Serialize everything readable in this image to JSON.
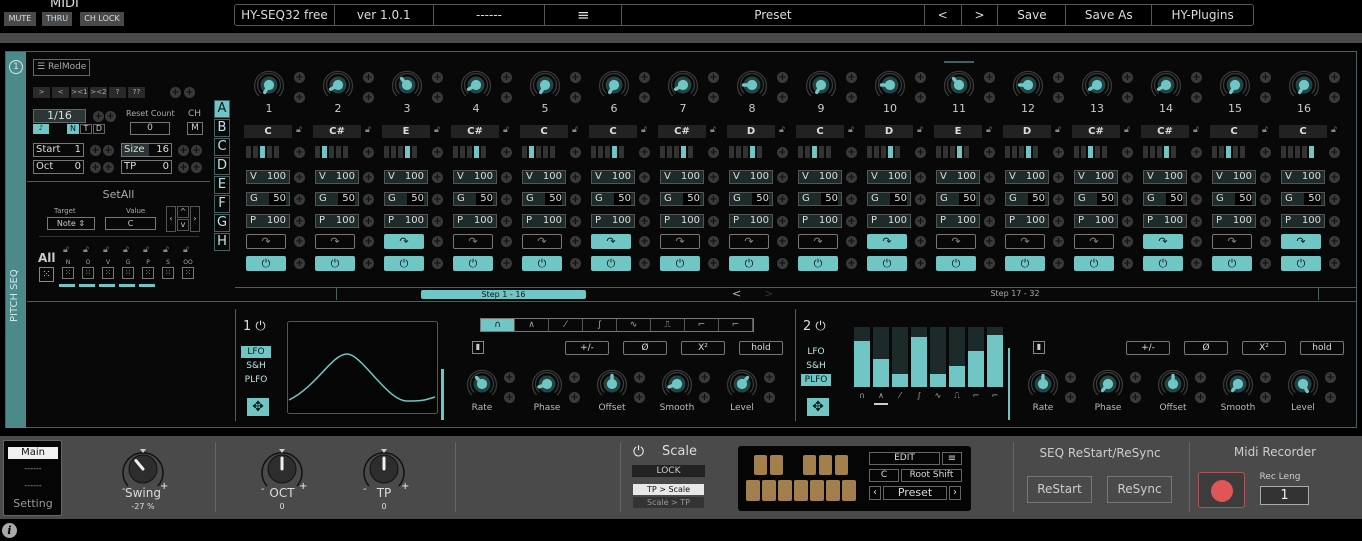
{
  "midi": {
    "title": "MIDI",
    "buttons": [
      "MUTE",
      "THRU",
      "CH LOCK"
    ]
  },
  "header": {
    "plugin": "HY-SEQ32 free",
    "version": "ver 1.0.1",
    "slot": "------",
    "menu_icon": "hamburger-icon",
    "preset": "Preset",
    "prev": "<",
    "next": ">",
    "save": "Save",
    "save_as": "Save As",
    "brand": "HY-Plugins"
  },
  "sidebar": {
    "label": "PITCH SEQ",
    "info": "1"
  },
  "controls": {
    "relmode": "RelMode",
    "directions": [
      ">",
      "<",
      "><1",
      "><2",
      "?",
      "??"
    ],
    "rate": "1/16",
    "rate_types": [
      "N",
      "T",
      "D"
    ],
    "reset_count_label": "Reset Count",
    "reset_count": "0",
    "ch_label": "CH",
    "ch_value": "M",
    "start_label": "Start",
    "start": "1",
    "size_label": "Size",
    "size": "16",
    "oct_label": "Oct",
    "oct": "0",
    "tp_label": "TP",
    "tp": "0",
    "setall": "SetAll",
    "target_label": "Target",
    "target": "Note",
    "value_label": "Value",
    "value": "C",
    "all": "All",
    "random_labels": [
      "N",
      "O",
      "V",
      "G",
      "P",
      "S",
      "OO"
    ]
  },
  "patterns": [
    "A",
    "B",
    "C",
    "D",
    "E",
    "F",
    "G",
    "H"
  ],
  "selected_pattern": "A",
  "steps": [
    {
      "n": "1",
      "note": "C",
      "oct": 2,
      "v": "100",
      "g": "50",
      "p": "100",
      "retrig": false,
      "on": true,
      "knob": -150
    },
    {
      "n": "2",
      "note": "C#",
      "oct": 1,
      "v": "100",
      "g": "50",
      "p": "100",
      "retrig": false,
      "on": true,
      "knob": -120
    },
    {
      "n": "3",
      "note": "E",
      "oct": 3,
      "v": "100",
      "g": "50",
      "p": "100",
      "retrig": true,
      "on": true,
      "knob": -40
    },
    {
      "n": "4",
      "note": "C#",
      "oct": 3,
      "v": "100",
      "g": "50",
      "p": "100",
      "retrig": false,
      "on": true,
      "knob": -120
    },
    {
      "n": "5",
      "note": "C",
      "oct": 1,
      "v": "100",
      "g": "50",
      "p": "100",
      "retrig": false,
      "on": true,
      "knob": -150
    },
    {
      "n": "6",
      "note": "C",
      "oct": 3,
      "v": "100",
      "g": "50",
      "p": "100",
      "retrig": true,
      "on": true,
      "knob": -150
    },
    {
      "n": "7",
      "note": "C#",
      "oct": 3,
      "v": "100",
      "g": "50",
      "p": "100",
      "retrig": false,
      "on": true,
      "knob": -120
    },
    {
      "n": "8",
      "note": "D",
      "oct": 3,
      "v": "100",
      "g": "50",
      "p": "100",
      "retrig": false,
      "on": true,
      "knob": -90
    },
    {
      "n": "9",
      "note": "C",
      "oct": 2,
      "v": "100",
      "g": "50",
      "p": "100",
      "retrig": false,
      "on": true,
      "knob": -150
    },
    {
      "n": "10",
      "note": "D",
      "oct": 3,
      "v": "100",
      "g": "50",
      "p": "100",
      "retrig": true,
      "on": true,
      "knob": -90
    },
    {
      "n": "11",
      "note": "E",
      "oct": 3,
      "v": "100",
      "g": "50",
      "p": "100",
      "retrig": false,
      "on": true,
      "knob": -40
    },
    {
      "n": "12",
      "note": "D",
      "oct": 3,
      "v": "100",
      "g": "50",
      "p": "100",
      "retrig": false,
      "on": true,
      "knob": -90
    },
    {
      "n": "13",
      "note": "C#",
      "oct": 2,
      "v": "100",
      "g": "50",
      "p": "100",
      "retrig": false,
      "on": true,
      "knob": -120
    },
    {
      "n": "14",
      "note": "C#",
      "oct": 3,
      "v": "100",
      "g": "50",
      "p": "100",
      "retrig": true,
      "on": true,
      "knob": -120
    },
    {
      "n": "15",
      "note": "C",
      "oct": 2,
      "v": "100",
      "g": "50",
      "p": "100",
      "retrig": false,
      "on": true,
      "knob": -150
    },
    {
      "n": "16",
      "note": "C",
      "oct": 4,
      "v": "100",
      "g": "50",
      "p": "100",
      "retrig": true,
      "on": true,
      "knob": -150
    }
  ],
  "current_step": "11",
  "step_pages": {
    "page1": "Step   1 - 16",
    "page2": "Step   17 - 32",
    "prev": "<",
    "next": ">"
  },
  "lfo1": {
    "num": "1",
    "modes": [
      "LFO",
      "S&H",
      "PLFO"
    ],
    "selected": "LFO",
    "shapes": [
      "sine",
      "triangle",
      "ramp",
      "s-curve",
      "zigzag",
      "step1",
      "step2",
      "step3"
    ],
    "shape_selected": 0,
    "ops": [
      "+/-",
      "Ø",
      "X²",
      "hold"
    ],
    "knobs": [
      "Rate",
      "Phase",
      "Offset",
      "Smooth",
      "Level"
    ],
    "level": 0.85
  },
  "lfo2": {
    "num": "2",
    "modes": [
      "LFO",
      "S&H",
      "PLFO"
    ],
    "selected": "PLFO",
    "bars": [
      0.77,
      0.46,
      0.22,
      0.83,
      0.22,
      0.35,
      0.6,
      0.87
    ],
    "bar_selected": 1,
    "ops": [
      "+/-",
      "Ø",
      "X²",
      "hold"
    ],
    "knobs": [
      "Rate",
      "Phase",
      "Offset",
      "Smooth",
      "Level"
    ],
    "level": 0.85
  },
  "bottom": {
    "tabs": [
      "Main",
      "------",
      "------",
      "Setting"
    ],
    "active_tab": "Main",
    "swing_label": "Swing",
    "swing_value": "-27 %",
    "oct_label": "OCT",
    "oct_value": "0",
    "tp_label": "TP",
    "tp_value": "0",
    "scale_label": "Scale",
    "lock": "LOCK",
    "tp_scale": "TP > Scale",
    "scale_tp": "Scale > TP",
    "edit": "EDIT",
    "root": "C",
    "root_shift": "Root Shift",
    "preset": "Preset",
    "seq_title": "SEQ ReStart/ReSync",
    "restart": "ReStart",
    "resync": "ReSync",
    "rec_title": "Midi Recorder",
    "rec_leng_label": "Rec Leng",
    "rec_leng": "1"
  },
  "colors": {
    "accent": "#6fc6c4",
    "keys": "#a37f4c",
    "rec": "#e05555"
  }
}
